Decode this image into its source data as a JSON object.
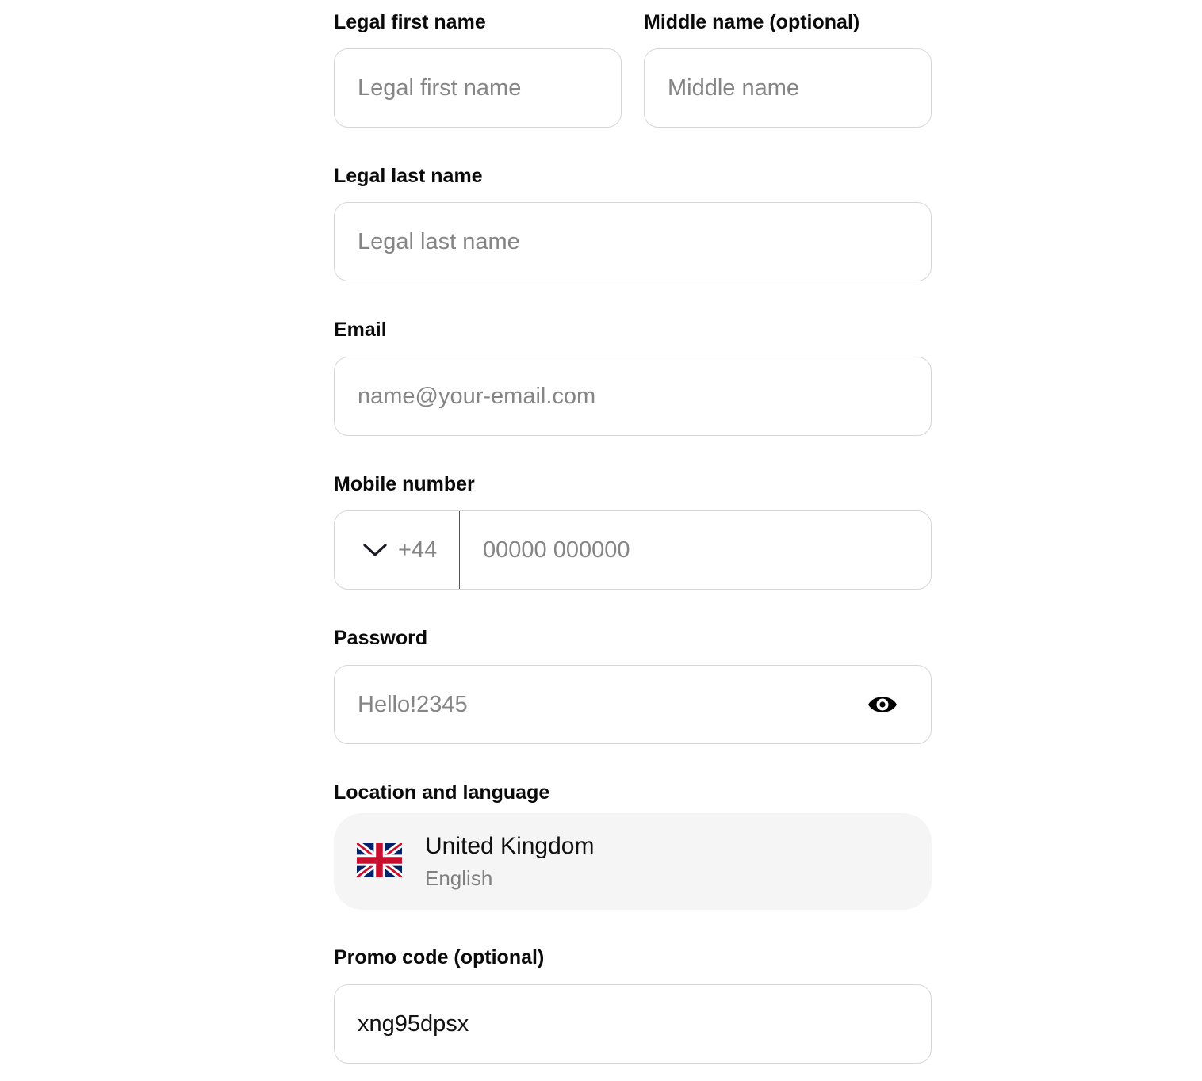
{
  "form": {
    "first_name": {
      "label": "Legal first name",
      "placeholder": "Legal first name",
      "value": ""
    },
    "middle_name": {
      "label": "Middle name (optional)",
      "placeholder": "Middle name",
      "value": ""
    },
    "last_name": {
      "label": "Legal last name",
      "placeholder": "Legal last name",
      "value": ""
    },
    "email": {
      "label": "Email",
      "placeholder": "name@your-email.com",
      "value": ""
    },
    "mobile": {
      "label": "Mobile number",
      "country_code": "+44",
      "placeholder": "00000 000000",
      "value": ""
    },
    "password": {
      "label": "Password",
      "value": "Hello!2345",
      "toggle_icon": "eye-icon"
    },
    "location": {
      "label": "Location and language",
      "country": "United Kingdom",
      "language": "English",
      "flag_icon": "uk-flag-icon"
    },
    "promo": {
      "label": "Promo code (optional)",
      "value": "xng95dpsx"
    }
  },
  "colors": {
    "border": "#d6d6d6",
    "placeholder": "#858585",
    "location_bg": "#f5f5f5",
    "flag_red": "#c8102e",
    "flag_blue": "#012169"
  }
}
